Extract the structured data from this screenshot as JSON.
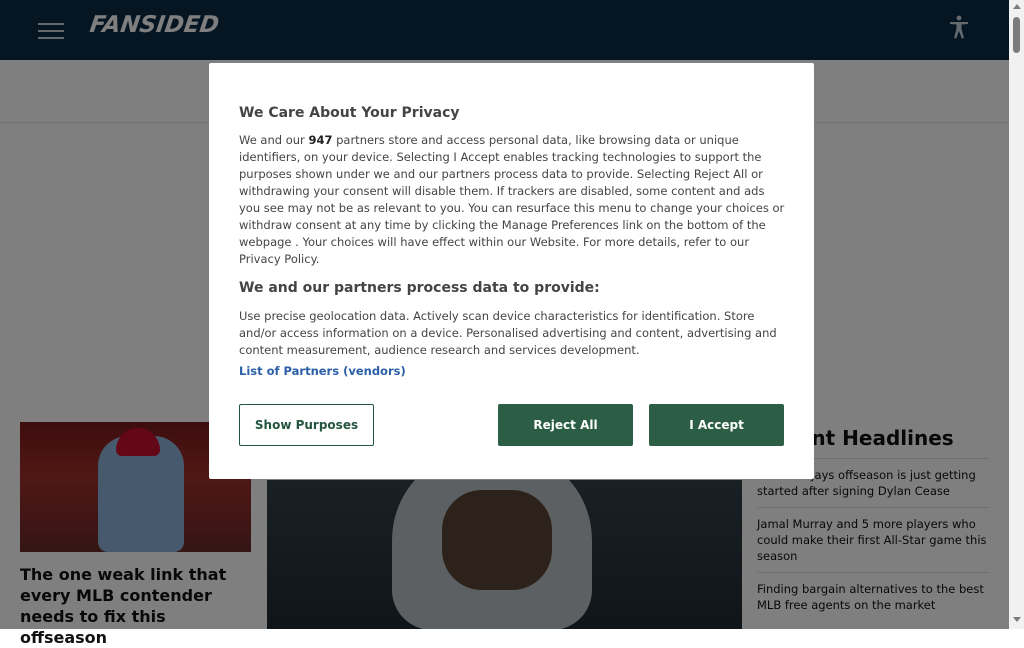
{
  "header": {
    "logo_text": "FANSIDED",
    "menu_icon": "hamburger-menu-icon",
    "accessibility_icon": "accessibility-icon"
  },
  "left_card": {
    "title": "The one weak link that every MLB contender needs to fix this offseason"
  },
  "recent": {
    "heading": "Recent Headlines",
    "items": [
      "The Blue Jays offseason is just getting started after signing Dylan Cease",
      "Jamal Murray and 5 more players who could make their first All-Star game this season",
      "Finding bargain alternatives to the best MLB free agents on the market"
    ]
  },
  "consent": {
    "title": "We Care About Your Privacy",
    "intro_prefix": "We and our ",
    "partners_count": "947",
    "intro_rest": " partners store and access personal data, like browsing data or unique identifiers, on your device. Selecting I Accept enables tracking technologies to support the purposes shown under we and our partners process data to provide. Selecting Reject All or withdrawing your consent will disable them. If trackers are disabled, some content and ads you see may not be as relevant to you. You can resurface this menu to change your choices or withdraw consent at any time by clicking the Manage Preferences link on the bottom of the webpage . Your choices will have effect within our Website. For more details, refer to our Privacy Policy.",
    "process_heading": "We and our partners process data to provide:",
    "process_text": "Use precise geolocation data. Actively scan device characteristics for identification. Store and/or access information on a device. Personalised advertising and content, advertising and content measurement, audience research and services development.",
    "partners_link": "List of Partners (vendors)",
    "show_purposes": "Show Purposes",
    "reject_all": "Reject All",
    "accept": "I Accept"
  },
  "colors": {
    "header_bg": "#0b2a44",
    "button_green": "#2b5e45",
    "link_blue": "#2b5fa8"
  }
}
